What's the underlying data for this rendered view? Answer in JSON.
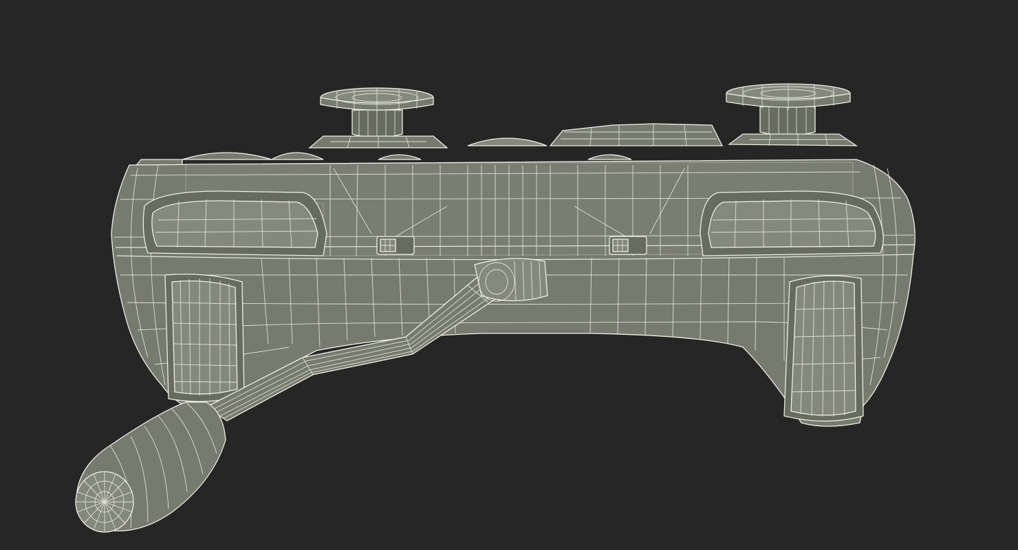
{
  "scene": {
    "background": "#262626",
    "model_fill": "#777a6e",
    "wire_color": "#eef0e4"
  },
  "model": {
    "subject": "gamepad-controller-with-boom-microphone",
    "render_style": "wireframe-over-shaded"
  }
}
